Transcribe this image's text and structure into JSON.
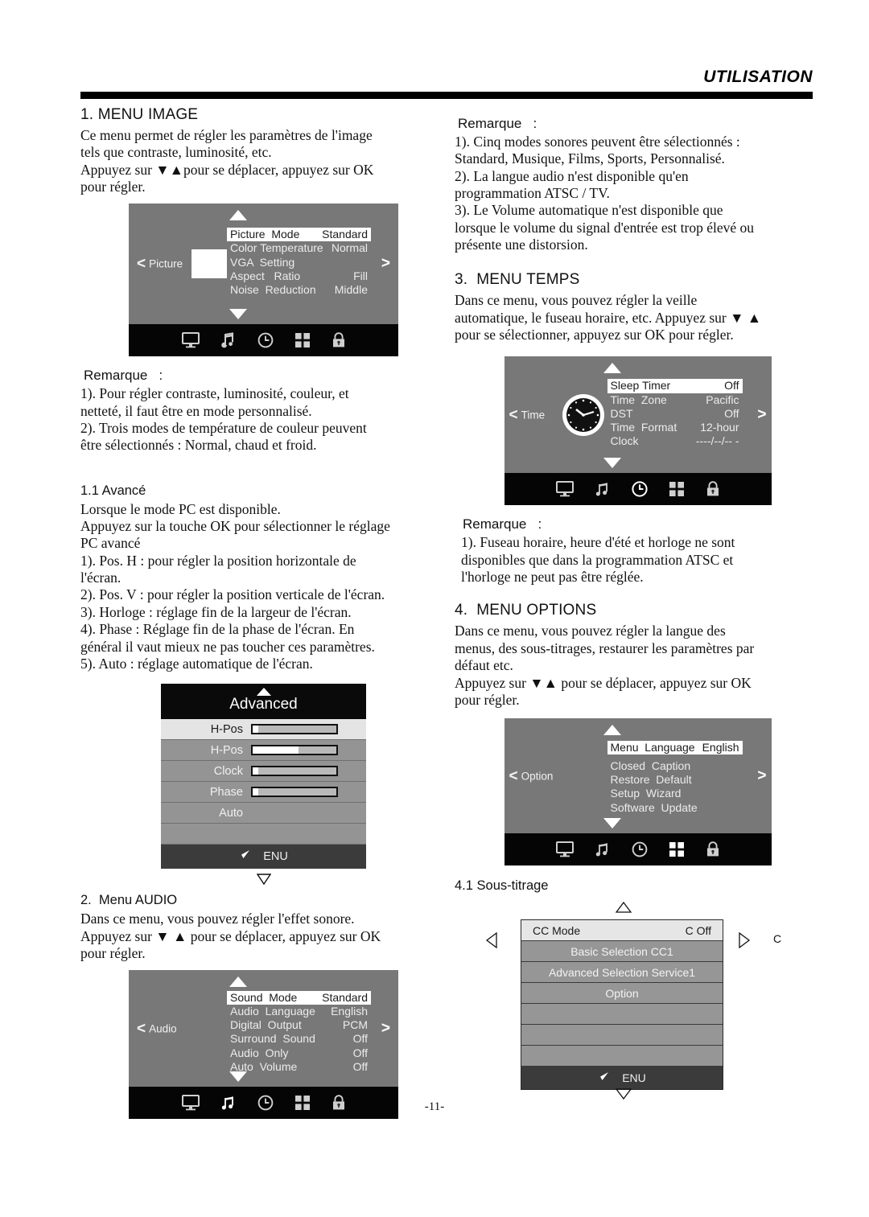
{
  "header": {
    "title": "UTILISATION"
  },
  "page_number": "-11-",
  "left_column": {
    "section1": {
      "heading": "1. MENU IMAGE",
      "body": "Ce menu permet de régler les paramètres de l'image\ntels que contraste, luminosité, etc.\nAppuyez sur ▼▲pour se déplacer, appuyez sur OK\npour régler."
    },
    "picture_osd": {
      "side_label": "Picture",
      "left_chevron": "<",
      "right_chevron": ">",
      "rows": [
        {
          "key": "Picture  Mode",
          "value": "Standard",
          "selected": true
        },
        {
          "key": "Color Temperature",
          "value": "Normal",
          "selected": false
        },
        {
          "key": "VGA  Setting",
          "value": "",
          "selected": false
        },
        {
          "key": "Aspect   Ratio",
          "value": "Fill",
          "selected": false
        },
        {
          "key": "Noise  Reduction",
          "value": "Middle",
          "selected": false
        }
      ],
      "icons": [
        "monitor-icon",
        "music-note-icon",
        "clock-icon",
        "grid-icon",
        "lock-icon"
      ]
    },
    "remarque1": {
      "label": "Remarque   :",
      "body": "1). Pour régler contraste, luminosité, couleur, et\nnetteté, il faut être en mode personnalisé.\n2). Trois modes de température de couleur peuvent\nêtre sélectionnés : Normal, chaud et froid."
    },
    "section1_1": {
      "heading": "1.1 Avancé",
      "body": "Lorsque le mode PC est disponible.\nAppuyez sur la touche OK pour sélectionner le réglage\nPC avancé\n1). Pos. H : pour régler la position horizontale de\nl'écran.\n2). Pos. V : pour régler la position verticale de l'écran.\n3). Horloge : réglage fin de la largeur de l'écran.\n4). Phase : Réglage fin de la phase de l'écran. En\ngénéral il vaut mieux ne pas toucher ces paramètres.\n5). Auto : réglage automatique de l'écran."
    },
    "advanced_osd": {
      "title": "Advanced",
      "rows": [
        {
          "label": "H-Pos",
          "slider": 6,
          "selected": true
        },
        {
          "label": "H-Pos",
          "slider": 55,
          "selected": false
        },
        {
          "label": "Clock",
          "slider": 6,
          "selected": false
        },
        {
          "label": "Phase",
          "slider": 6,
          "selected": false
        },
        {
          "label": "Auto",
          "slider": null,
          "selected": false
        },
        {
          "label": "",
          "slider": null,
          "selected": false
        }
      ],
      "footer_label": "ENU"
    },
    "section2": {
      "heading": "2.  Menu AUDIO",
      "body": "Dans ce menu, vous pouvez régler l'effet sonore.\nAppuyez sur ▼ ▲  pour se déplacer, appuyez sur OK\npour régler."
    },
    "audio_osd": {
      "side_label": "Audio",
      "left_chevron": "<",
      "right_chevron": ">",
      "rows": [
        {
          "key": "Sound  Mode",
          "value": "Standard",
          "selected": true
        },
        {
          "key": "Audio  Language",
          "value": "English",
          "selected": false
        },
        {
          "key": "Digital  Output",
          "value": "PCM",
          "selected": false
        },
        {
          "key": "Surround  Sound",
          "value": "Off",
          "selected": false
        },
        {
          "key": "Audio  Only",
          "value": "Off",
          "selected": false
        },
        {
          "key": "Auto  Volume",
          "value": "Off",
          "selected": false
        }
      ],
      "icons": [
        "monitor-icon",
        "music-note-icon",
        "clock-icon",
        "grid-icon",
        "lock-icon"
      ]
    }
  },
  "right_column": {
    "remarque_audio": {
      "label": "Remarque   :",
      "body": "1). Cinq modes sonores peuvent être sélectionnés :\nStandard, Musique, Films, Sports, Personnalisé.\n2). La langue audio n'est disponible qu'en\nprogrammation ATSC / TV.\n3). Le Volume automatique n'est disponible que\nlorsque le volume du signal d'entrée est trop élevé ou\nprésente une distorsion."
    },
    "section3": {
      "heading": "3.  MENU TEMPS",
      "body": "Dans ce menu, vous pouvez régler la veille\nautomatique, le fuseau horaire, etc. Appuyez sur ▼ ▲\npour se sélectionner, appuyez sur OK pour régler."
    },
    "time_osd": {
      "side_label": "Time",
      "left_chevron": "<",
      "right_chevron": ">",
      "rows": [
        {
          "key": "Sleep Timer",
          "value": "Off",
          "selected": true
        },
        {
          "key": "Time  Zone",
          "value": "Pacific",
          "selected": false
        },
        {
          "key": "DST",
          "value": "Off",
          "selected": false
        },
        {
          "key": "Time  Format",
          "value": "12-hour",
          "selected": false
        },
        {
          "key": "Clock",
          "value": "----/--/-- -",
          "selected": false
        }
      ],
      "icons": [
        "monitor-icon",
        "music-note-icon",
        "clock-icon",
        "grid-icon",
        "lock-icon"
      ]
    },
    "remarque_time": {
      "label": "Remarque   :",
      "body": "1). Fuseau horaire, heure d'été et horloge ne sont\ndisponibles que dans la programmation ATSC et\nl'horloge ne peut pas être réglée."
    },
    "section4": {
      "heading": "4.  MENU OPTIONS",
      "body": "Dans ce menu, vous pouvez régler la langue des\nmenus, des sous-titrages, restaurer les paramètres par\ndéfaut etc.\nAppuyez sur  ▼▲  pour se déplacer, appuyez sur OK\npour régler."
    },
    "option_osd": {
      "side_label": "Option",
      "left_chevron": "<",
      "right_chevron": ">",
      "rows": [
        {
          "key": "Menu  Language",
          "value": "English",
          "selected": true
        },
        {
          "key": "Closed  Caption",
          "value": "",
          "selected": false
        },
        {
          "key": "Restore  Default",
          "value": "",
          "selected": false
        },
        {
          "key": "Setup  Wizard",
          "value": "",
          "selected": false
        },
        {
          "key": "Software  Update",
          "value": "",
          "selected": false
        }
      ],
      "icons": [
        "monitor-icon",
        "music-note-icon",
        "clock-icon",
        "grid-icon",
        "lock-icon"
      ]
    },
    "section4_1": {
      "heading": "4.1 Sous-titrage"
    },
    "cc_osd": {
      "rows": [
        {
          "key": "CC  Mode",
          "value": "C  Off",
          "selected": true
        },
        {
          "key": "Basic  Selection  CC1",
          "value": "",
          "selected": false
        },
        {
          "key": "Advanced  Selection  Service1",
          "value": "",
          "selected": false
        },
        {
          "key": "Option",
          "value": "",
          "selected": false
        },
        {
          "key": "",
          "value": "",
          "selected": false
        },
        {
          "key": "",
          "value": "",
          "selected": false
        },
        {
          "key": "",
          "value": "",
          "selected": false
        }
      ],
      "footer_label": "ENU",
      "outside_label": "C"
    }
  },
  "colors": {
    "osd_background": "#787878",
    "osd_selected": "#ffffff",
    "iconbar": "#050505",
    "adv_row": "#949494",
    "adv_row_first": "#e4e4e4",
    "adv_footer": "#3b3b3b"
  }
}
